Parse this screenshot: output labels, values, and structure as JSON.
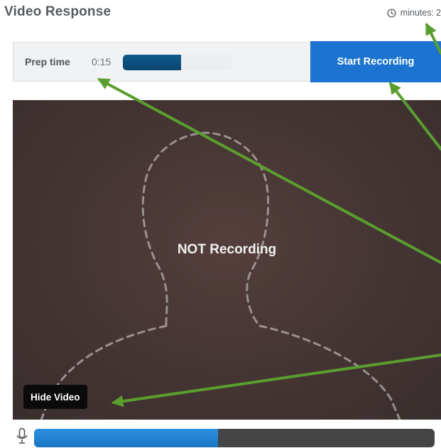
{
  "header": {
    "title": "Video Response",
    "minutes_label": "minutes:",
    "minutes_value": "2"
  },
  "prep": {
    "label": "Prep time",
    "time": "0:15",
    "progress_fraction": 0.53
  },
  "record": {
    "start_label": "Start Recording"
  },
  "video": {
    "status_text": "NOT Recording",
    "hide_label": "Hide Video"
  },
  "audio": {
    "level_fraction": 0.46
  },
  "colors": {
    "accent": "#1d74d0",
    "prep_fill": "#0f5a8c",
    "level_fill": "#2a8fde",
    "arrow": "#5a9e2f"
  },
  "icons": {
    "clock": "clock-icon",
    "mic": "microphone-icon"
  }
}
